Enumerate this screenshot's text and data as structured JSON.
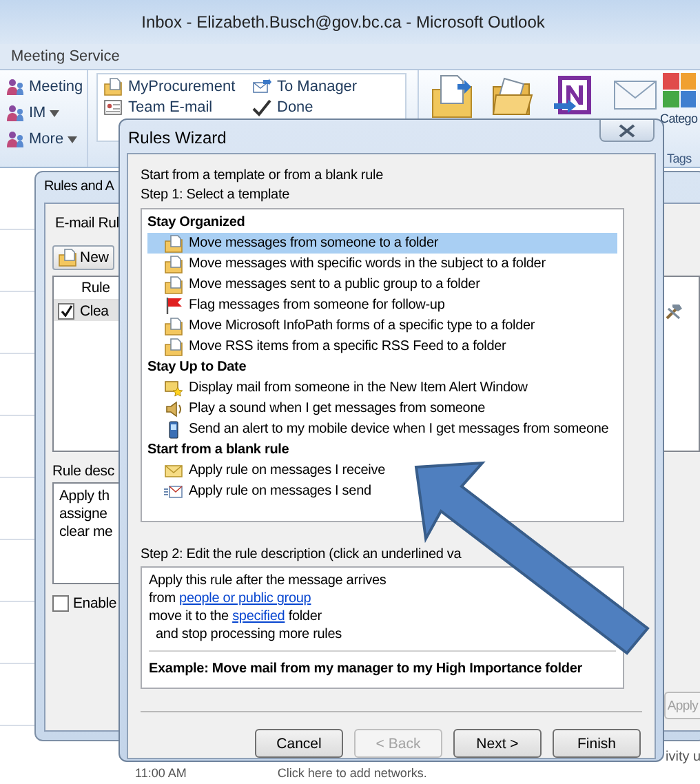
{
  "window": {
    "title": "Inbox - Elizabeth.Busch@gov.bc.ca - Microsoft Outlook"
  },
  "ribbon": {
    "tab_label": "Meeting Service",
    "respond_items": [
      {
        "label": "Meeting",
        "dropdown": false
      },
      {
        "label": "IM",
        "dropdown": true
      },
      {
        "label": "More",
        "dropdown": true
      }
    ],
    "quick_steps": [
      {
        "label": "MyProcurement",
        "kind": "folder"
      },
      {
        "label": "To Manager",
        "kind": "envelope"
      },
      {
        "label": "Team E-mail",
        "kind": "card"
      },
      {
        "label": "Done",
        "kind": "check"
      }
    ],
    "categorize_label": "Catego",
    "group_label": "Tags"
  },
  "rules_and_alerts": {
    "title": "Rules and A",
    "tab": "E-mail Rul",
    "new_button": "New",
    "column": "Rule",
    "rules": [
      {
        "name": "Clea",
        "checked": true
      }
    ],
    "description_label": "Rule desc",
    "description_lines": [
      "Apply th",
      "assigne",
      "clear me"
    ],
    "enable": {
      "label": "Enable",
      "checked": false
    },
    "apply_button": {
      "label": "Apply",
      "disabled": true
    }
  },
  "wizard": {
    "title": "Rules Wizard",
    "intro": "Start from a template or from a blank rule",
    "step1": "Step 1: Select a template",
    "groups": [
      {
        "heading": "Stay Organized",
        "items": [
          {
            "label": "Move messages from someone to a folder",
            "kind": "move",
            "selected": true
          },
          {
            "label": "Move messages with specific words in the subject to a folder",
            "kind": "move",
            "selected": false
          },
          {
            "label": "Move messages sent to a public group to a folder",
            "kind": "move",
            "selected": false
          },
          {
            "label": "Flag messages from someone for follow-up",
            "kind": "flag",
            "selected": false
          },
          {
            "label": "Move Microsoft InfoPath forms of a specific type to a folder",
            "kind": "move",
            "selected": false
          },
          {
            "label": "Move RSS items from a specific RSS Feed to a folder",
            "kind": "move",
            "selected": false
          }
        ]
      },
      {
        "heading": "Stay Up to Date",
        "items": [
          {
            "label": "Display mail from someone in the New Item Alert Window",
            "kind": "alert",
            "selected": false
          },
          {
            "label": "Play a sound when I get messages from someone",
            "kind": "sound",
            "selected": false
          },
          {
            "label": "Send an alert to my mobile device when I get messages from someone",
            "kind": "mobile",
            "selected": false
          }
        ]
      },
      {
        "heading": "Start from a blank rule",
        "items": [
          {
            "label": "Apply rule on messages I receive",
            "kind": "receive",
            "selected": false
          },
          {
            "label": "Apply rule on messages I send",
            "kind": "send",
            "selected": false
          }
        ]
      }
    ],
    "step2": "Step 2: Edit the rule description (click an underlined va",
    "description": [
      {
        "text": "Apply this rule after the message arrives",
        "kind": "plain"
      },
      {
        "text": "from ",
        "link": "people or public group",
        "kind": "plain"
      },
      {
        "text": "move it to the ",
        "link": "specified",
        "after": " folder",
        "kind": "plain"
      },
      {
        "text": "and stop processing more rules",
        "kind": "indented"
      }
    ],
    "example": "Example: Move mail from my manager to my High Importance folder",
    "buttons": [
      {
        "label": "Cancel",
        "disabled": false
      },
      {
        "label": "< Back",
        "disabled": true
      },
      {
        "label": "Next >",
        "disabled": false
      },
      {
        "label": "Finish",
        "disabled": false
      }
    ]
  },
  "background": {
    "side_text": "ivity u",
    "time": "11:00 AM",
    "hint": "Click here to add networks."
  }
}
